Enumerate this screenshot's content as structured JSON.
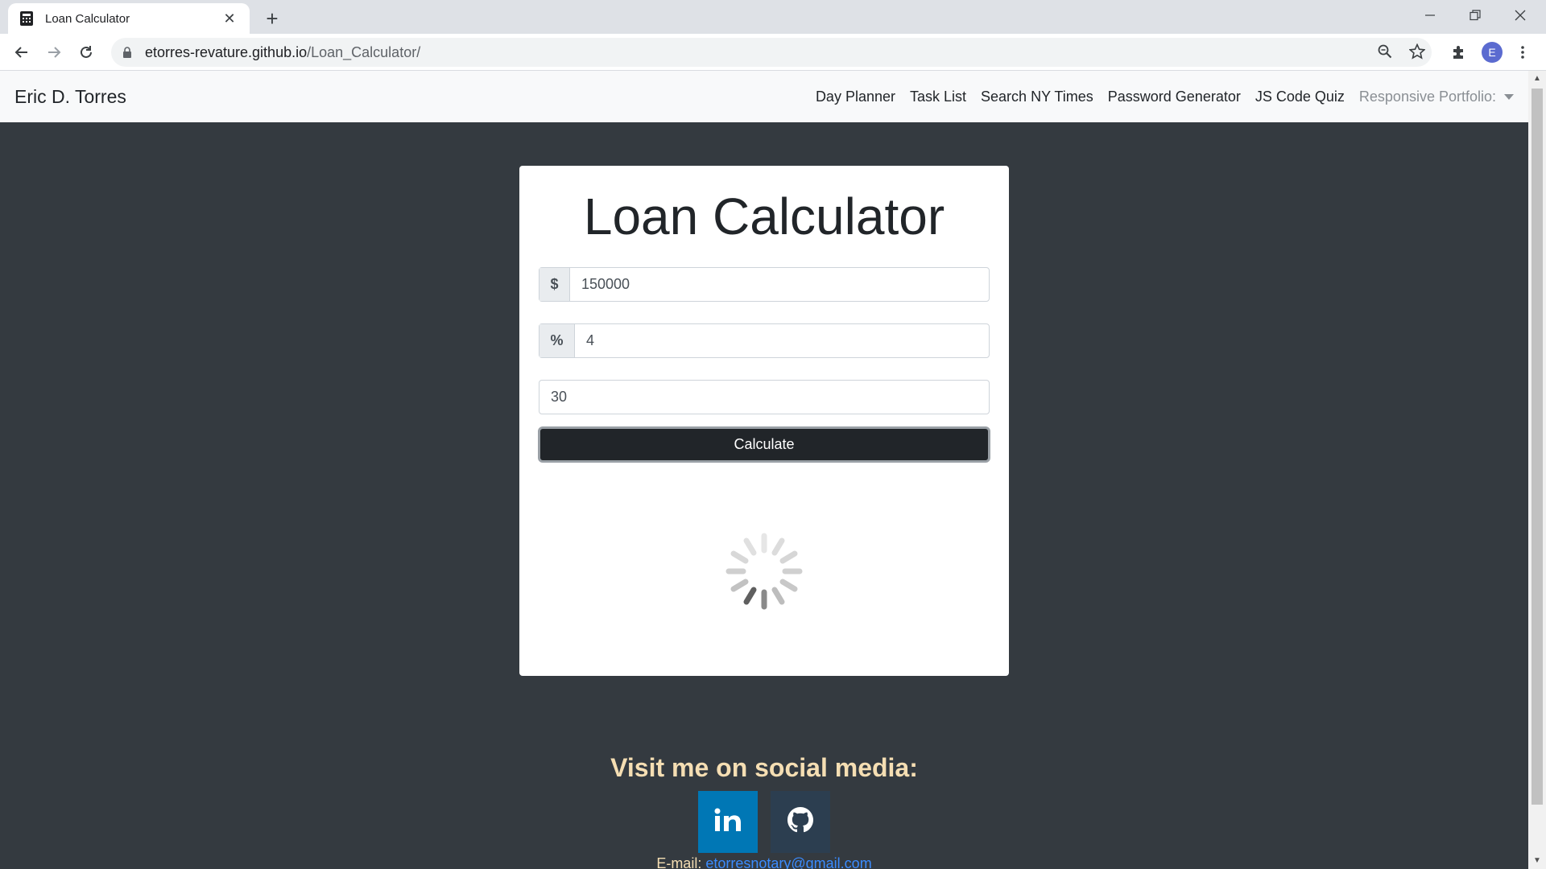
{
  "browser": {
    "tab_title": "Loan Calculator",
    "url_host": "etorres-revature.github.io",
    "url_path": "/Loan_Calculator/",
    "profile_initial": "E"
  },
  "navbar": {
    "brand": "Eric D. Torres",
    "links": [
      "Day Planner",
      "Task List",
      "Search NY Times",
      "Password Generator",
      "JS Code Quiz"
    ],
    "dropdown_label": "Responsive Portfolio:"
  },
  "calculator": {
    "title": "Loan Calculator",
    "amount_addon": "$",
    "amount_value": "150000",
    "interest_addon": "%",
    "interest_value": "4",
    "years_value": "30",
    "button_label": "Calculate"
  },
  "footer": {
    "heading": "Visit me on social media:",
    "email_label": "E-mail:",
    "email": "etorresnotary@gmail.com",
    "linkedin_color": "#0077b5",
    "github_color": "#2c3e50"
  }
}
